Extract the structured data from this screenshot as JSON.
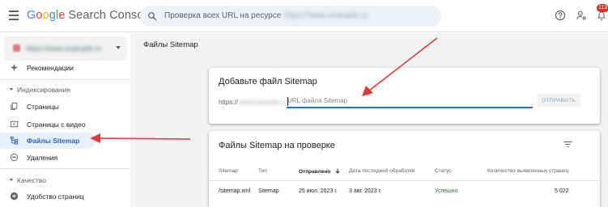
{
  "header": {
    "logo_letters": [
      "G",
      "o",
      "o",
      "g",
      "l",
      "e"
    ],
    "product": "Search Console",
    "search_placeholder": "Проверка всех URL на ресурсе",
    "search_property": "https://www.example.ru",
    "notification_count": "113"
  },
  "sidebar": {
    "property": "https://www.example.ru",
    "items": {
      "recommendations": "Рекомендации",
      "indexing_section": "Индексирование",
      "pages": "Страницы",
      "video_pages": "Страницы с видео",
      "sitemaps": "Файлы Sitemap",
      "removals": "Удаления",
      "quality_section": "Качество",
      "page_experience": "Удобство страниц"
    }
  },
  "main": {
    "page_title": "Файлы Sitemap",
    "add_card": {
      "title": "Добавьте файл Sitemap",
      "prefix": "https://",
      "domain": "www.example.ru",
      "slash": "/",
      "input_placeholder": "URL файла Sitemap",
      "submit_label": "ОТПРАВИТЬ"
    },
    "list_card": {
      "title": "Файлы Sitemap на проверке",
      "columns": {
        "sitemap": "Sitemap",
        "type": "Тип",
        "submitted": "Отправлено",
        "last_read": "Дата последней обработки",
        "status": "Статус",
        "discovered": "Количество выявленных страниц"
      },
      "rows": [
        {
          "sitemap": "/sitemap.xml",
          "type": "Sitemap",
          "submitted": "25 июл. 2023 г.",
          "last_read": "3 авг. 2023 г.",
          "status": "Успешно",
          "discovered": "5 022"
        }
      ]
    }
  },
  "colors": {
    "accent": "#1a73e8",
    "active_bg": "#e8f0fe",
    "active_text": "#1967d2",
    "success": "#188038",
    "annotation_arrow": "#e53935",
    "badge": "#d93025"
  }
}
